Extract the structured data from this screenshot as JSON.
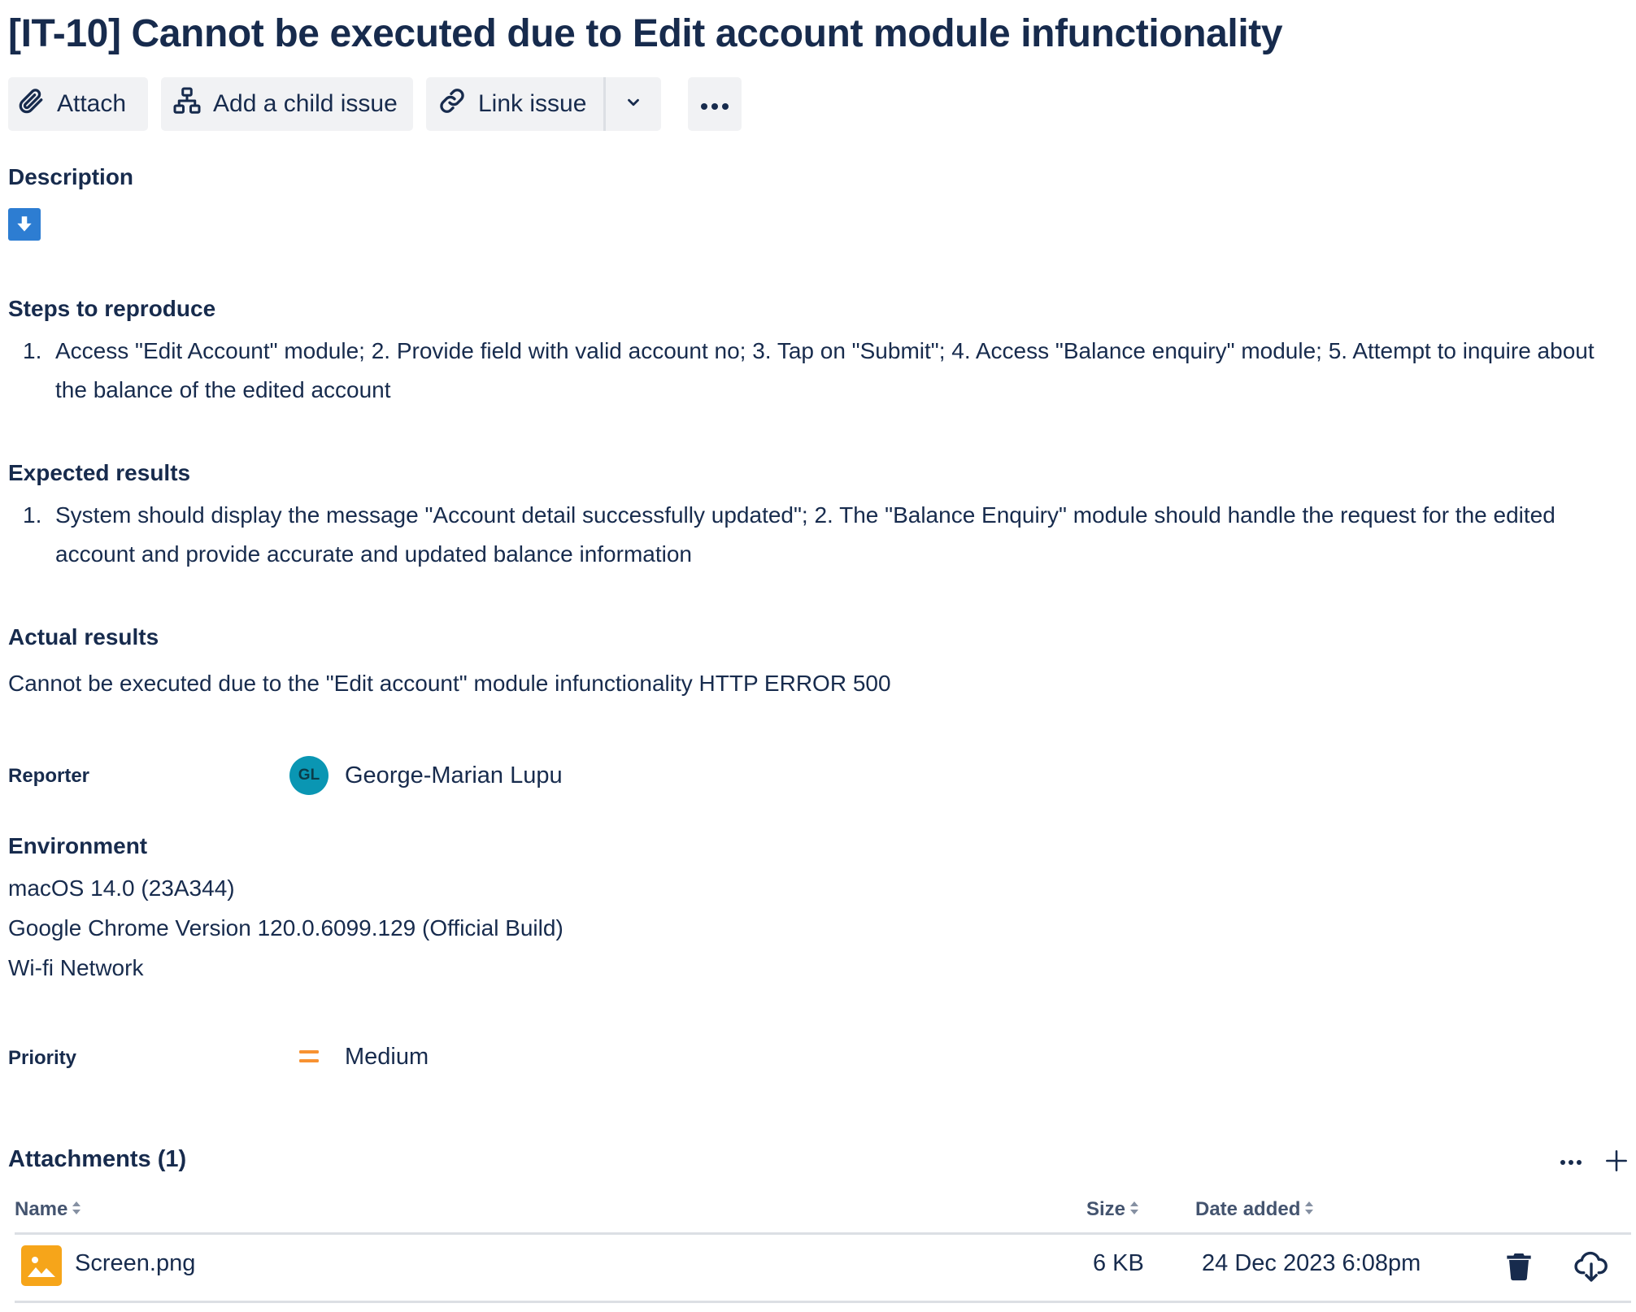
{
  "issue": {
    "title": "[IT-10] Cannot be executed due to Edit account module infunctionality"
  },
  "toolbar": {
    "attach_label": "Attach",
    "add_child_label": "Add a child issue",
    "link_issue_label": "Link issue",
    "icons": {
      "attach": "paperclip-icon",
      "add_child": "child-issue-icon",
      "link": "link-icon",
      "dropdown": "chevron-down-icon",
      "more": "more-icon"
    }
  },
  "description": {
    "heading": "Description",
    "icon": "download-arrow-icon"
  },
  "steps": {
    "heading": "Steps to reproduce",
    "items": [
      {
        "num": "1.",
        "text": "Access \"Edit Account\" module; 2. Provide field with valid account no; 3. Tap on \"Submit\"; 4. Access \"Balance enquiry\" module; 5. Attempt to inquire about the balance of the edited account"
      }
    ]
  },
  "expected": {
    "heading": "Expected results",
    "items": [
      {
        "num": "1.",
        "text": "System should display the message \"Account detail successfully updated\"; 2. The \"Balance Enquiry\" module should handle the request for the edited account and provide accurate and updated balance information"
      }
    ]
  },
  "actual": {
    "heading": "Actual results",
    "text": "Cannot be executed due to the \"Edit account\" module infunctionality HTTP ERROR 500"
  },
  "reporter": {
    "label": "Reporter",
    "initials": "GL",
    "name": "George-Marian Lupu",
    "avatar_color": "#0a96b3"
  },
  "environment": {
    "heading": "Environment",
    "lines": [
      "macOS 14.0 (23A344)",
      "Google Chrome Version 120.0.6099.129 (Official Build)",
      "Wi-fi Network"
    ]
  },
  "priority": {
    "label": "Priority",
    "value": "Medium",
    "icon": "priority-medium-icon",
    "color": "#f79232"
  },
  "attachments": {
    "title": "Attachments (1)",
    "columns": {
      "name": "Name",
      "size": "Size",
      "date": "Date added"
    },
    "rows": [
      {
        "name": "Screen.png",
        "size": "6 KB",
        "date": "24 Dec 2023 6:08pm",
        "icon": "image-file-icon"
      }
    ]
  },
  "colors": {
    "text": "#172b4d",
    "button_bg": "#f1f2f4",
    "accent_blue": "#2d7dd2",
    "file_icon": "#f6a51a"
  }
}
